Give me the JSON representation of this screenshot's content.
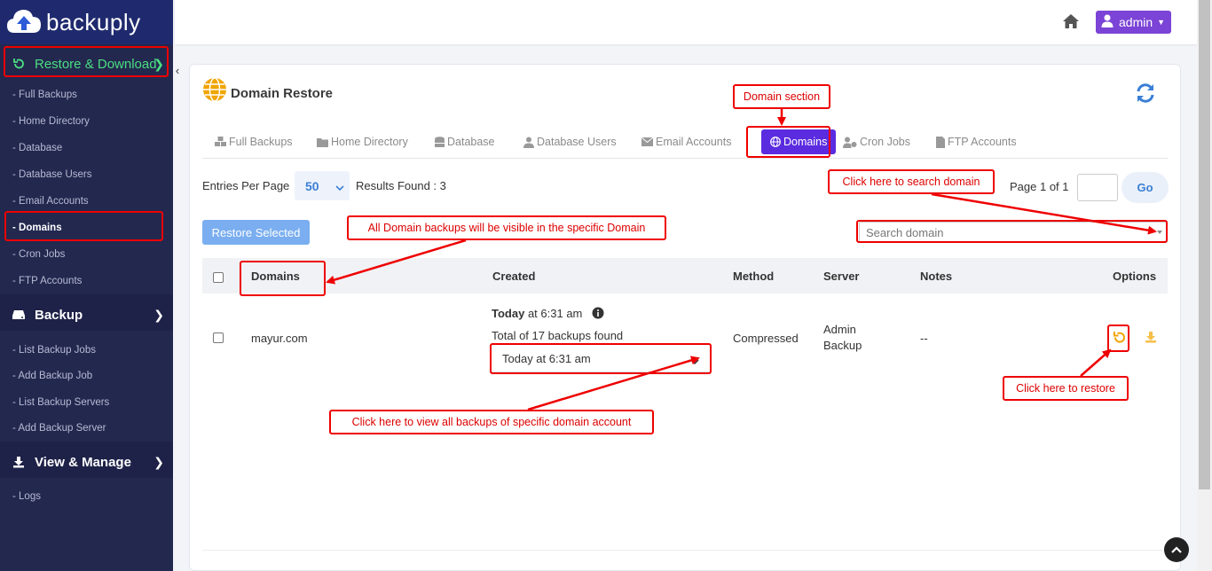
{
  "brand": {
    "name": "backuply"
  },
  "sidebar": {
    "sections": [
      {
        "label": "Restore & Download",
        "items": [
          "- Full Backups",
          "- Home Directory",
          "- Database",
          "- Database Users",
          "- Email Accounts",
          "- Domains",
          "- Cron Jobs",
          "- FTP Accounts"
        ]
      },
      {
        "label": "Backup",
        "items": [
          "- List Backup Jobs",
          "- Add Backup Job",
          "- List Backup Servers",
          "- Add Backup Server"
        ]
      },
      {
        "label": "View & Manage",
        "items": [
          "- Logs"
        ]
      }
    ],
    "active_item": "- Domains"
  },
  "topbar": {
    "user_label": "admin"
  },
  "card": {
    "title": "Domain Restore",
    "tabs": [
      {
        "label": "Full Backups",
        "icon": "cubes-icon"
      },
      {
        "label": "Home Directory",
        "icon": "folder-icon"
      },
      {
        "label": "Database",
        "icon": "database-icon"
      },
      {
        "label": "Database Users",
        "icon": "users-icon"
      },
      {
        "label": "Email Accounts",
        "icon": "envelope-icon"
      },
      {
        "label": "Domains",
        "icon": "globe-icon",
        "active": true
      },
      {
        "label": "Cron Jobs",
        "icon": "user-cog-icon"
      },
      {
        "label": "FTP Accounts",
        "icon": "file-icon"
      }
    ],
    "entries_label": "Entries Per Page",
    "entries_value": "50",
    "results_label": "Results Found : 3",
    "page_label": "Page 1 of 1",
    "go_label": "Go",
    "restore_selected_label": "Restore Selected",
    "search_placeholder": "Search domain"
  },
  "table": {
    "headers": [
      "Domains",
      "Created",
      "Method",
      "Server",
      "Notes",
      "Options"
    ],
    "rows": [
      {
        "domain": "mayur.com",
        "created_day": "Today",
        "created_time": "at 6:31 am",
        "total_backups": "Total of 17 backups found",
        "selected_backup": "Today at 6:31 am",
        "method": "Compressed",
        "server_line1": "Admin",
        "server_line2": "Backup",
        "notes": "--"
      }
    ]
  },
  "annotations": {
    "domain_section": "Domain section",
    "search_domain": "Click here to search domain",
    "domain_visible": "All Domain backups will be visible in the specific Domain",
    "view_backups": "Click here to view all backups of specific domain account",
    "restore": "Click here to restore"
  },
  "colors": {
    "sidebar_bg": "#23284f",
    "brand_bg": "#1f2a6e",
    "accent_purple": "#5b2be0",
    "admin_button": "#7b43d6",
    "annotation_red": "#e00000",
    "active_green": "#4ade80",
    "restore_orange": "#f0a500"
  }
}
